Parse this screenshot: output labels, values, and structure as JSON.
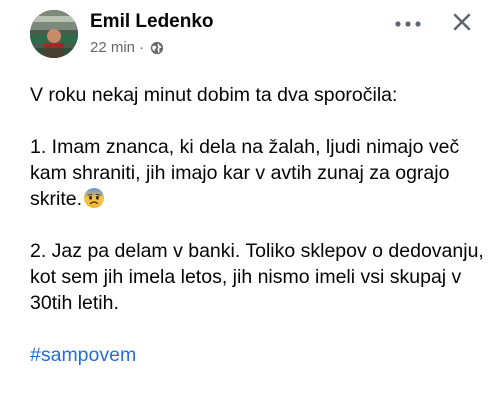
{
  "post": {
    "author": "Emil Ledenko",
    "time": "22 min",
    "separator": "·",
    "privacy_icon": "globe-icon",
    "more_icon": "more-horizontal-icon",
    "close_icon": "close-icon",
    "paragraphs": [
      "V roku nekaj minut dobim ta dva sporočila:",
      "1. Imam znanca, ki dela na žalah, ljudi nimajo več kam shraniti, jih imajo kar v avtih zunaj za ograjo skrite.",
      "2. Jaz pa delam v banki. Toliko sklepov o dedovanju, kot sem jih imela letos, jih nismo imeli vsi skupaj v 30tih letih."
    ],
    "emoji": "anxious-face-with-sweat-icon",
    "hashtag": "#sampovem"
  },
  "colors": {
    "text": "#050505",
    "secondary": "#65676b",
    "hashtag": "#216fdb",
    "icon": "#606770"
  }
}
